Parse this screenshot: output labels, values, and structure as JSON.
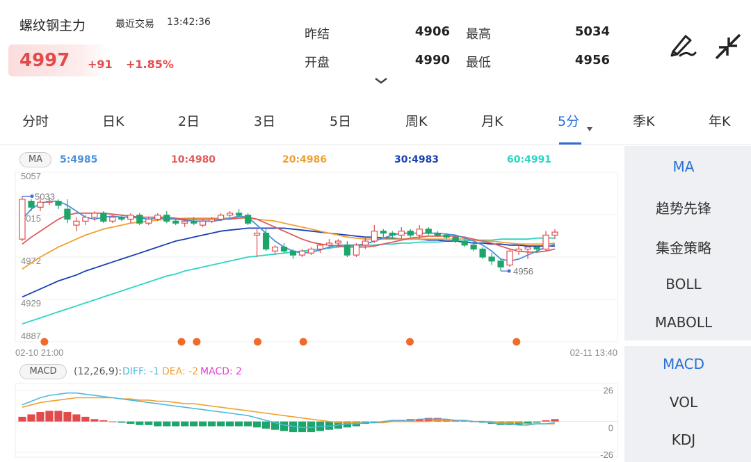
{
  "header": {
    "title": "螺纹钢主力",
    "status_label": "最近交易",
    "time": "13:42:36",
    "price": "4997",
    "change": "+91",
    "change_pct": "+1.85%",
    "quotes": [
      {
        "label": "昨结",
        "value": "4906"
      },
      {
        "label": "最高",
        "value": "5034"
      },
      {
        "label": "开盘",
        "value": "4990"
      },
      {
        "label": "最低",
        "value": "4956"
      }
    ],
    "icons": [
      "draw-pen-icon",
      "collapse-arrows-icon",
      "chevron-down-icon"
    ]
  },
  "tabs": [
    {
      "label": "分时"
    },
    {
      "label": "日K"
    },
    {
      "label": "2日"
    },
    {
      "label": "3日"
    },
    {
      "label": "5日"
    },
    {
      "label": "周K"
    },
    {
      "label": "月K"
    },
    {
      "label": "5分",
      "active": true
    },
    {
      "label": "季K"
    },
    {
      "label": "年K"
    }
  ],
  "ma_legend": {
    "tag": "MA",
    "items": [
      {
        "text": "5:4985",
        "color": "#4a90d9"
      },
      {
        "text": "10:4980",
        "color": "#e05a5a"
      },
      {
        "text": "20:4986",
        "color": "#f0a030"
      },
      {
        "text": "30:4983",
        "color": "#1a3fb5"
      },
      {
        "text": "60:4991",
        "color": "#2ad4c4"
      }
    ]
  },
  "macd_legend": {
    "tag": "MACD",
    "params": "(12,26,9):",
    "items": [
      {
        "text": "DIFF: -1",
        "color": "#4fb8e0"
      },
      {
        "text": "DEA: -2",
        "color": "#f0a030"
      },
      {
        "text": "MACD: 2",
        "color": "#e040d0"
      }
    ]
  },
  "chart_data": [
    {
      "type": "candlestick",
      "y_tick_labels": [
        "5057",
        "5015",
        "4972",
        "4929",
        "4887"
      ],
      "ylim": [
        4887,
        5057
      ],
      "x_labels": [
        "02-10 21:00",
        "02-11 13:40"
      ],
      "annotations": [
        "5033",
        "4956"
      ],
      "candles": [
        [
          4990,
          5033,
          4988,
          5030
        ],
        [
          5028,
          5030,
          5018,
          5022
        ],
        [
          5022,
          5030,
          5018,
          5027
        ],
        [
          5027,
          5032,
          5024,
          5028
        ],
        [
          5028,
          5030,
          5020,
          5024
        ],
        [
          5020,
          5030,
          5006,
          5010
        ],
        [
          5004,
          5012,
          4998,
          5008
        ],
        [
          5008,
          5014,
          5004,
          5012
        ],
        [
          5012,
          5018,
          5008,
          5016
        ],
        [
          5016,
          5018,
          5006,
          5008
        ],
        [
          5008,
          5014,
          5006,
          5012
        ],
        [
          5012,
          5014,
          5008,
          5010
        ],
        [
          5010,
          5016,
          5006,
          5014
        ],
        [
          5014,
          5016,
          5004,
          5006
        ],
        [
          5006,
          5012,
          5004,
          5010
        ],
        [
          5010,
          5016,
          5008,
          5014
        ],
        [
          5014,
          5018,
          5006,
          5008
        ],
        [
          5008,
          5010,
          5004,
          5006
        ],
        [
          5006,
          5010,
          5002,
          5008
        ],
        [
          5008,
          5012,
          5004,
          5006
        ],
        [
          5004,
          5010,
          5002,
          5008
        ],
        [
          5008,
          5012,
          5006,
          5010
        ],
        [
          5010,
          5016,
          5008,
          5014
        ],
        [
          5014,
          5018,
          5012,
          5016
        ],
        [
          5016,
          5020,
          5012,
          5014
        ],
        [
          5014,
          5016,
          5004,
          5006
        ],
        [
          4994,
          5000,
          4972,
          4996
        ],
        [
          4996,
          5000,
          4978,
          4980
        ],
        [
          4978,
          4984,
          4974,
          4982
        ],
        [
          4982,
          4986,
          4976,
          4978
        ],
        [
          4978,
          4980,
          4970,
          4974
        ],
        [
          4974,
          4980,
          4972,
          4978
        ],
        [
          4976,
          4982,
          4974,
          4980
        ],
        [
          4980,
          4986,
          4976,
          4984
        ],
        [
          4984,
          4990,
          4980,
          4986
        ],
        [
          4986,
          4990,
          4982,
          4988
        ],
        [
          4984,
          4988,
          4972,
          4974
        ],
        [
          4974,
          4986,
          4972,
          4984
        ],
        [
          4984,
          4992,
          4980,
          4988
        ],
        [
          4988,
          5004,
          4986,
          4998
        ],
        [
          4998,
          5000,
          4992,
          4996
        ],
        [
          4996,
          4998,
          4990,
          4994
        ],
        [
          4994,
          5002,
          4990,
          4998
        ],
        [
          4998,
          5000,
          4992,
          4994
        ],
        [
          4994,
          5004,
          4990,
          5000
        ],
        [
          5000,
          5002,
          4994,
          4996
        ],
        [
          4996,
          4998,
          4992,
          4994
        ],
        [
          4994,
          4996,
          4990,
          4992
        ],
        [
          4992,
          4994,
          4986,
          4988
        ],
        [
          4988,
          4990,
          4982,
          4984
        ],
        [
          4984,
          4986,
          4978,
          4980
        ],
        [
          4980,
          4982,
          4970,
          4972
        ],
        [
          4972,
          4976,
          4964,
          4968
        ],
        [
          4968,
          4970,
          4958,
          4962
        ],
        [
          4964,
          4980,
          4962,
          4978
        ],
        [
          4978,
          4984,
          4974,
          4980
        ],
        [
          4980,
          4984,
          4970,
          4982
        ],
        [
          4982,
          4984,
          4976,
          4980
        ],
        [
          4980,
          4998,
          4978,
          4994
        ],
        [
          4994,
          5000,
          4990,
          4997
        ]
      ],
      "ma_lines": {
        "MA5": [
          5010,
          5020,
          5026,
          5028,
          5028,
          5024,
          5018,
          5012,
          5010,
          5012,
          5013,
          5012,
          5012,
          5011,
          5010,
          5011,
          5011,
          5010,
          5009,
          5008,
          5008,
          5008,
          5009,
          5011,
          5013,
          5012,
          5004,
          4996,
          4988,
          4982,
          4978,
          4976,
          4977,
          4979,
          4982,
          4984,
          4984,
          4984,
          4985,
          4988,
          4991,
          4994,
          4996,
          4996,
          4996,
          4996,
          4996,
          4995,
          4994,
          4991,
          4988,
          4984,
          4978,
          4970,
          4968,
          4970,
          4974,
          4978,
          4982,
          4985
        ],
        "MA10": [
          4985,
          4992,
          4998,
          5004,
          5010,
          5014,
          5016,
          5016,
          5016,
          5016,
          5015,
          5014,
          5013,
          5012,
          5012,
          5012,
          5012,
          5011,
          5010,
          5010,
          5010,
          5010,
          5010,
          5010,
          5011,
          5012,
          5010,
          5006,
          5002,
          4998,
          4994,
          4990,
          4987,
          4985,
          4984,
          4983,
          4982,
          4982,
          4982,
          4983,
          4985,
          4987,
          4989,
          4991,
          4992,
          4993,
          4993,
          4993,
          4993,
          4992,
          4990,
          4988,
          4986,
          4983,
          4980,
          4978,
          4977,
          4977,
          4978,
          4980
        ],
        "MA20": [
          4960,
          4966,
          4972,
          4977,
          4982,
          4986,
          4990,
          4994,
          4997,
          5000,
          5002,
          5004,
          5006,
          5007,
          5008,
          5009,
          5010,
          5010,
          5011,
          5011,
          5011,
          5011,
          5011,
          5011,
          5011,
          5011,
          5010,
          5009,
          5008,
          5006,
          5004,
          5002,
          5000,
          4998,
          4996,
          4994,
          4992,
          4991,
          4990,
          4990,
          4990,
          4990,
          4990,
          4990,
          4990,
          4990,
          4990,
          4990,
          4990,
          4990,
          4989,
          4988,
          4988,
          4987,
          4986,
          4985,
          4985,
          4985,
          4985,
          4986
        ],
        "MA30": [
          4932,
          4936,
          4940,
          4944,
          4948,
          4951,
          4954,
          4958,
          4961,
          4964,
          4967,
          4970,
          4973,
          4976,
          4979,
          4982,
          4985,
          4988,
          4990,
          4992,
          4994,
          4996,
          4998,
          4999,
          5000,
          5001,
          5001,
          5001,
          5001,
          5001,
          5000,
          4999,
          4998,
          4997,
          4996,
          4995,
          4994,
          4993,
          4992,
          4992,
          4991,
          4991,
          4990,
          4990,
          4990,
          4989,
          4989,
          4988,
          4988,
          4987,
          4986,
          4986,
          4985,
          4985,
          4984,
          4984,
          4983,
          4983,
          4983,
          4983
        ],
        "MA60": [
          4905,
          4908,
          4911,
          4914,
          4917,
          4920,
          4923,
          4926,
          4929,
          4932,
          4935,
          4938,
          4941,
          4944,
          4947,
          4950,
          4953,
          4955,
          4958,
          4960,
          4962,
          4964,
          4966,
          4968,
          4970,
          4972,
          4973,
          4974,
          4975,
          4976,
          4977,
          4978,
          4979,
          4980,
          4981,
          4982,
          4983,
          4983,
          4984,
          4984,
          4985,
          4985,
          4986,
          4986,
          4987,
          4987,
          4987,
          4988,
          4988,
          4988,
          4989,
          4989,
          4989,
          4990,
          4990,
          4990,
          4990,
          4991,
          4991,
          4991
        ]
      },
      "signal_dots_at": [
        1,
        10,
        11,
        15,
        18,
        25,
        32
      ]
    },
    {
      "type": "bar",
      "series_name": "MACD",
      "y_tick_labels": [
        "26",
        "0",
        "-26"
      ],
      "ylim": [
        -30,
        32
      ],
      "values": [
        4,
        6,
        8,
        9,
        9,
        8,
        6,
        4,
        2,
        1,
        0,
        -1,
        -2,
        -3,
        -3,
        -4,
        -4,
        -4,
        -4,
        -4,
        -4,
        -4,
        -4,
        -4,
        -4,
        -4,
        -5,
        -6,
        -7,
        -8,
        -9,
        -9,
        -9,
        -8,
        -7,
        -6,
        -5,
        -4,
        -2,
        -1,
        0,
        1,
        1,
        2,
        2,
        3,
        3,
        2,
        1,
        1,
        0,
        -1,
        -2,
        -3,
        -3,
        -3,
        -2,
        -1,
        1,
        2
      ],
      "diff": [
        14,
        17,
        20,
        22,
        23,
        24,
        24,
        23,
        22,
        21,
        20,
        19,
        18,
        17,
        16,
        15,
        14,
        13,
        12,
        11,
        10,
        9,
        8,
        7,
        6,
        5,
        3,
        1,
        -1,
        -3,
        -4,
        -5,
        -5,
        -4,
        -4,
        -3,
        -2,
        -2,
        -1,
        -1,
        0,
        1,
        1,
        1,
        2,
        2,
        2,
        2,
        1,
        1,
        0,
        0,
        -1,
        -2,
        -2,
        -3,
        -3,
        -2,
        -2,
        -1
      ],
      "dea": [
        12,
        14,
        16,
        17,
        18,
        19,
        20,
        20,
        20,
        20,
        20,
        19,
        19,
        18,
        18,
        17,
        17,
        16,
        15,
        15,
        14,
        13,
        12,
        11,
        10,
        9,
        8,
        7,
        6,
        5,
        4,
        3,
        2,
        1,
        0,
        -1,
        -1,
        -1,
        -1,
        -1,
        -1,
        0,
        0,
        0,
        0,
        0,
        1,
        1,
        1,
        1,
        0,
        0,
        0,
        -1,
        -1,
        -1,
        -2,
        -2,
        -2,
        -2
      ]
    }
  ],
  "side": {
    "group1": [
      "MA",
      "趋势先锋",
      "集金策略",
      "BOLL",
      "MABOLL"
    ],
    "group2": [
      "MACD",
      "VOL",
      "KDJ"
    ]
  }
}
